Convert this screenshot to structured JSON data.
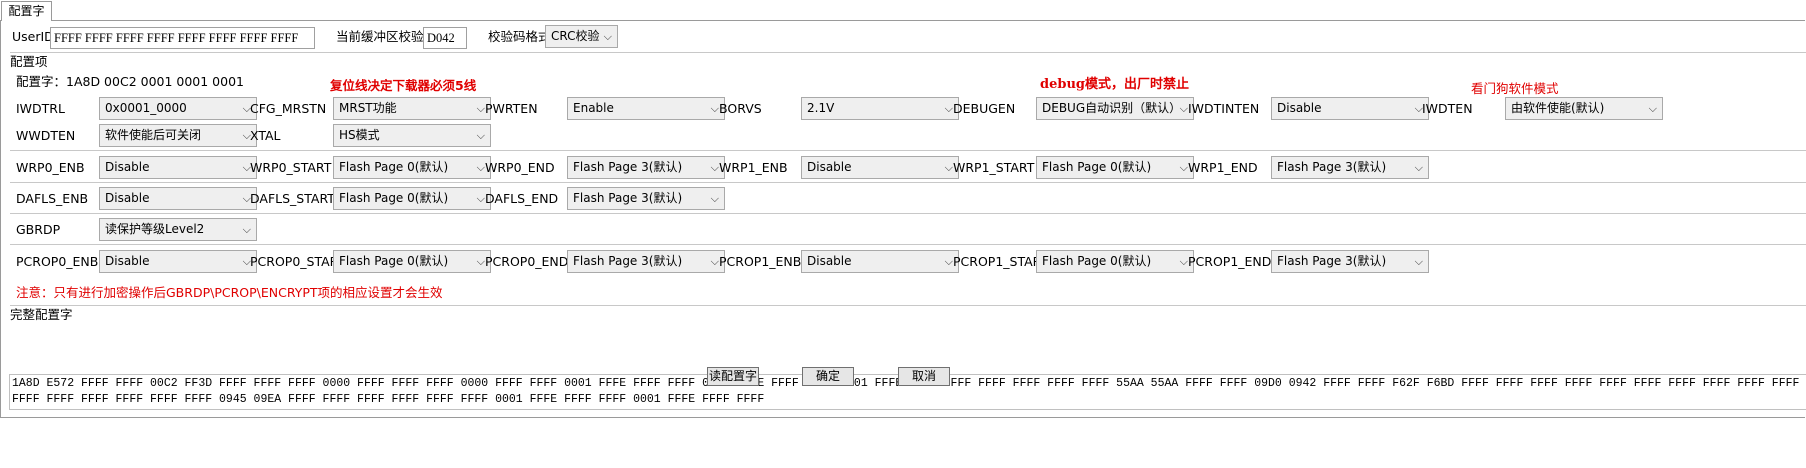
{
  "tab_label": "配置字",
  "userid_label": "UserID",
  "userid_value": "FFFF FFFF FFFF FFFF FFFF FFFF FFFF FFFF",
  "checksum_label": "当前缓冲区校验码",
  "checksum_value": "D042",
  "format_label": "校验码格式",
  "format_value": "CRC校验",
  "config_section": "配置项",
  "config_word": "配置字：1A8D 00C2 0001 0001 0001",
  "notes": {
    "reset": "复位线决定下载器必须5线",
    "debug": "debug模式，出厂时禁止",
    "watchdog": "看门狗软件模式",
    "encrypt": "注意：只有进行加密操作后GBRDP\\PCROP\\ENCRYPT项的相应设置才会生效"
  },
  "rows": [
    [
      {
        "label": "IWDTRL",
        "value": "0x0001_0000"
      },
      {
        "label": "CFG_MRSTN",
        "value": "MRST功能"
      },
      {
        "label": "PWRTEN",
        "value": "Enable"
      },
      {
        "label": "BORVS",
        "value": "2.1V"
      },
      {
        "label": "DEBUGEN",
        "value": "DEBUG自动识别（默认）"
      },
      {
        "label": "IWDTINTEN",
        "value": "Disable"
      },
      {
        "label": "IWDTEN",
        "value": "由软件使能(默认)"
      }
    ],
    [
      {
        "label": "WWDTEN",
        "value": "软件使能后可关闭"
      },
      {
        "label": "XTAL",
        "value": "HS模式"
      }
    ],
    [
      {
        "label": "WRP0_ENB",
        "value": "Disable"
      },
      {
        "label": "WRP0_START",
        "value": "Flash Page 0(默认)"
      },
      {
        "label": "WRP0_END",
        "value": "Flash Page 3(默认)"
      },
      {
        "label": "WRP1_ENB",
        "value": "Disable"
      },
      {
        "label": "WRP1_START",
        "value": "Flash Page 0(默认)"
      },
      {
        "label": "WRP1_END",
        "value": "Flash Page 3(默认)"
      }
    ],
    [
      {
        "label": "DAFLS_ENB",
        "value": "Disable"
      },
      {
        "label": "DAFLS_START",
        "value": "Flash Page 0(默认)"
      },
      {
        "label": "DAFLS_END",
        "value": "Flash Page 3(默认)"
      }
    ],
    [
      {
        "label": "GBRDP",
        "value": "读保护等级Level2"
      }
    ],
    [
      {
        "label": "PCROP0_ENB",
        "value": "Disable"
      },
      {
        "label": "PCROP0_START",
        "value": "Flash Page 0(默认)"
      },
      {
        "label": "PCROP0_END",
        "value": "Flash Page 3(默认)"
      },
      {
        "label": "PCROP1_ENB",
        "value": "Disable"
      },
      {
        "label": "PCROP1_START",
        "value": "Flash Page 0(默认)"
      },
      {
        "label": "PCROP1_END",
        "value": "Flash Page 3(默认)"
      }
    ]
  ],
  "full_section": "完整配置字",
  "full_lines": [
    "1A8D E572 FFFF FFFF 00C2 FF3D FFFF FFFF FFFF 0000 FFFF FFFF FFFF 0000 FFFF FFFF 0001 FFFE FFFF FFFF 0001 FFFE FFFF FFFF 0001 FFFE FFFF FFFF FFFF FFFF FFFF FFFF 55AA 55AA FFFF FFFF 09D0 0942 FFFF FFFF F62F F6BD FFFF FFFF FFFF FFFF FFFF FFFF FFFF FFFF FFFF FFFF FFFF FFFF",
    "FFFF FFFF FFFF FFFF FFFF FFFF 0945 09EA FFFF FFFF FFFF FFFF FFFF FFFF 0001 FFFE FFFF FFFF 0001 FFFE FFFF FFFF"
  ],
  "buttons": {
    "read": "读配置字",
    "ok": "确定",
    "cancel": "取消"
  }
}
